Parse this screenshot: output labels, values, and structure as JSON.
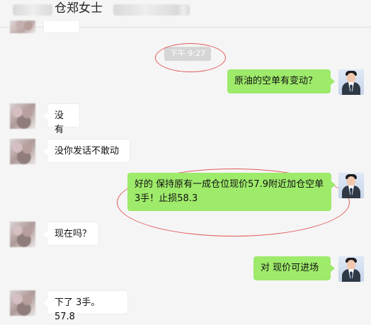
{
  "header": {
    "title_visible": "仓郑女士"
  },
  "timestamp": "下午 9:27",
  "messages": [
    {
      "side": "right",
      "text": "原油的空单有变动？"
    },
    {
      "side": "left",
      "text": "没有"
    },
    {
      "side": "left",
      "text": "没你发话不敢动"
    },
    {
      "side": "right",
      "text": "好的 保持原有一成仓位现价57.9附近加仓空单3手！止损58.3"
    },
    {
      "side": "left",
      "text": "现在吗？"
    },
    {
      "side": "right",
      "text": "对 现价可进场"
    },
    {
      "side": "left",
      "text": "下了 3手。57.8"
    }
  ],
  "colors": {
    "background": "#f5f5f5",
    "incoming_bubble": "#ffffff",
    "outgoing_bubble": "#9eea6a",
    "annotation_red": "#e25b5b",
    "timestamp_bg": "#d6d6d6"
  },
  "icons": {
    "incoming_avatar": "blurred-avatar-icon",
    "outgoing_avatar": "profile-avatar-icon"
  }
}
